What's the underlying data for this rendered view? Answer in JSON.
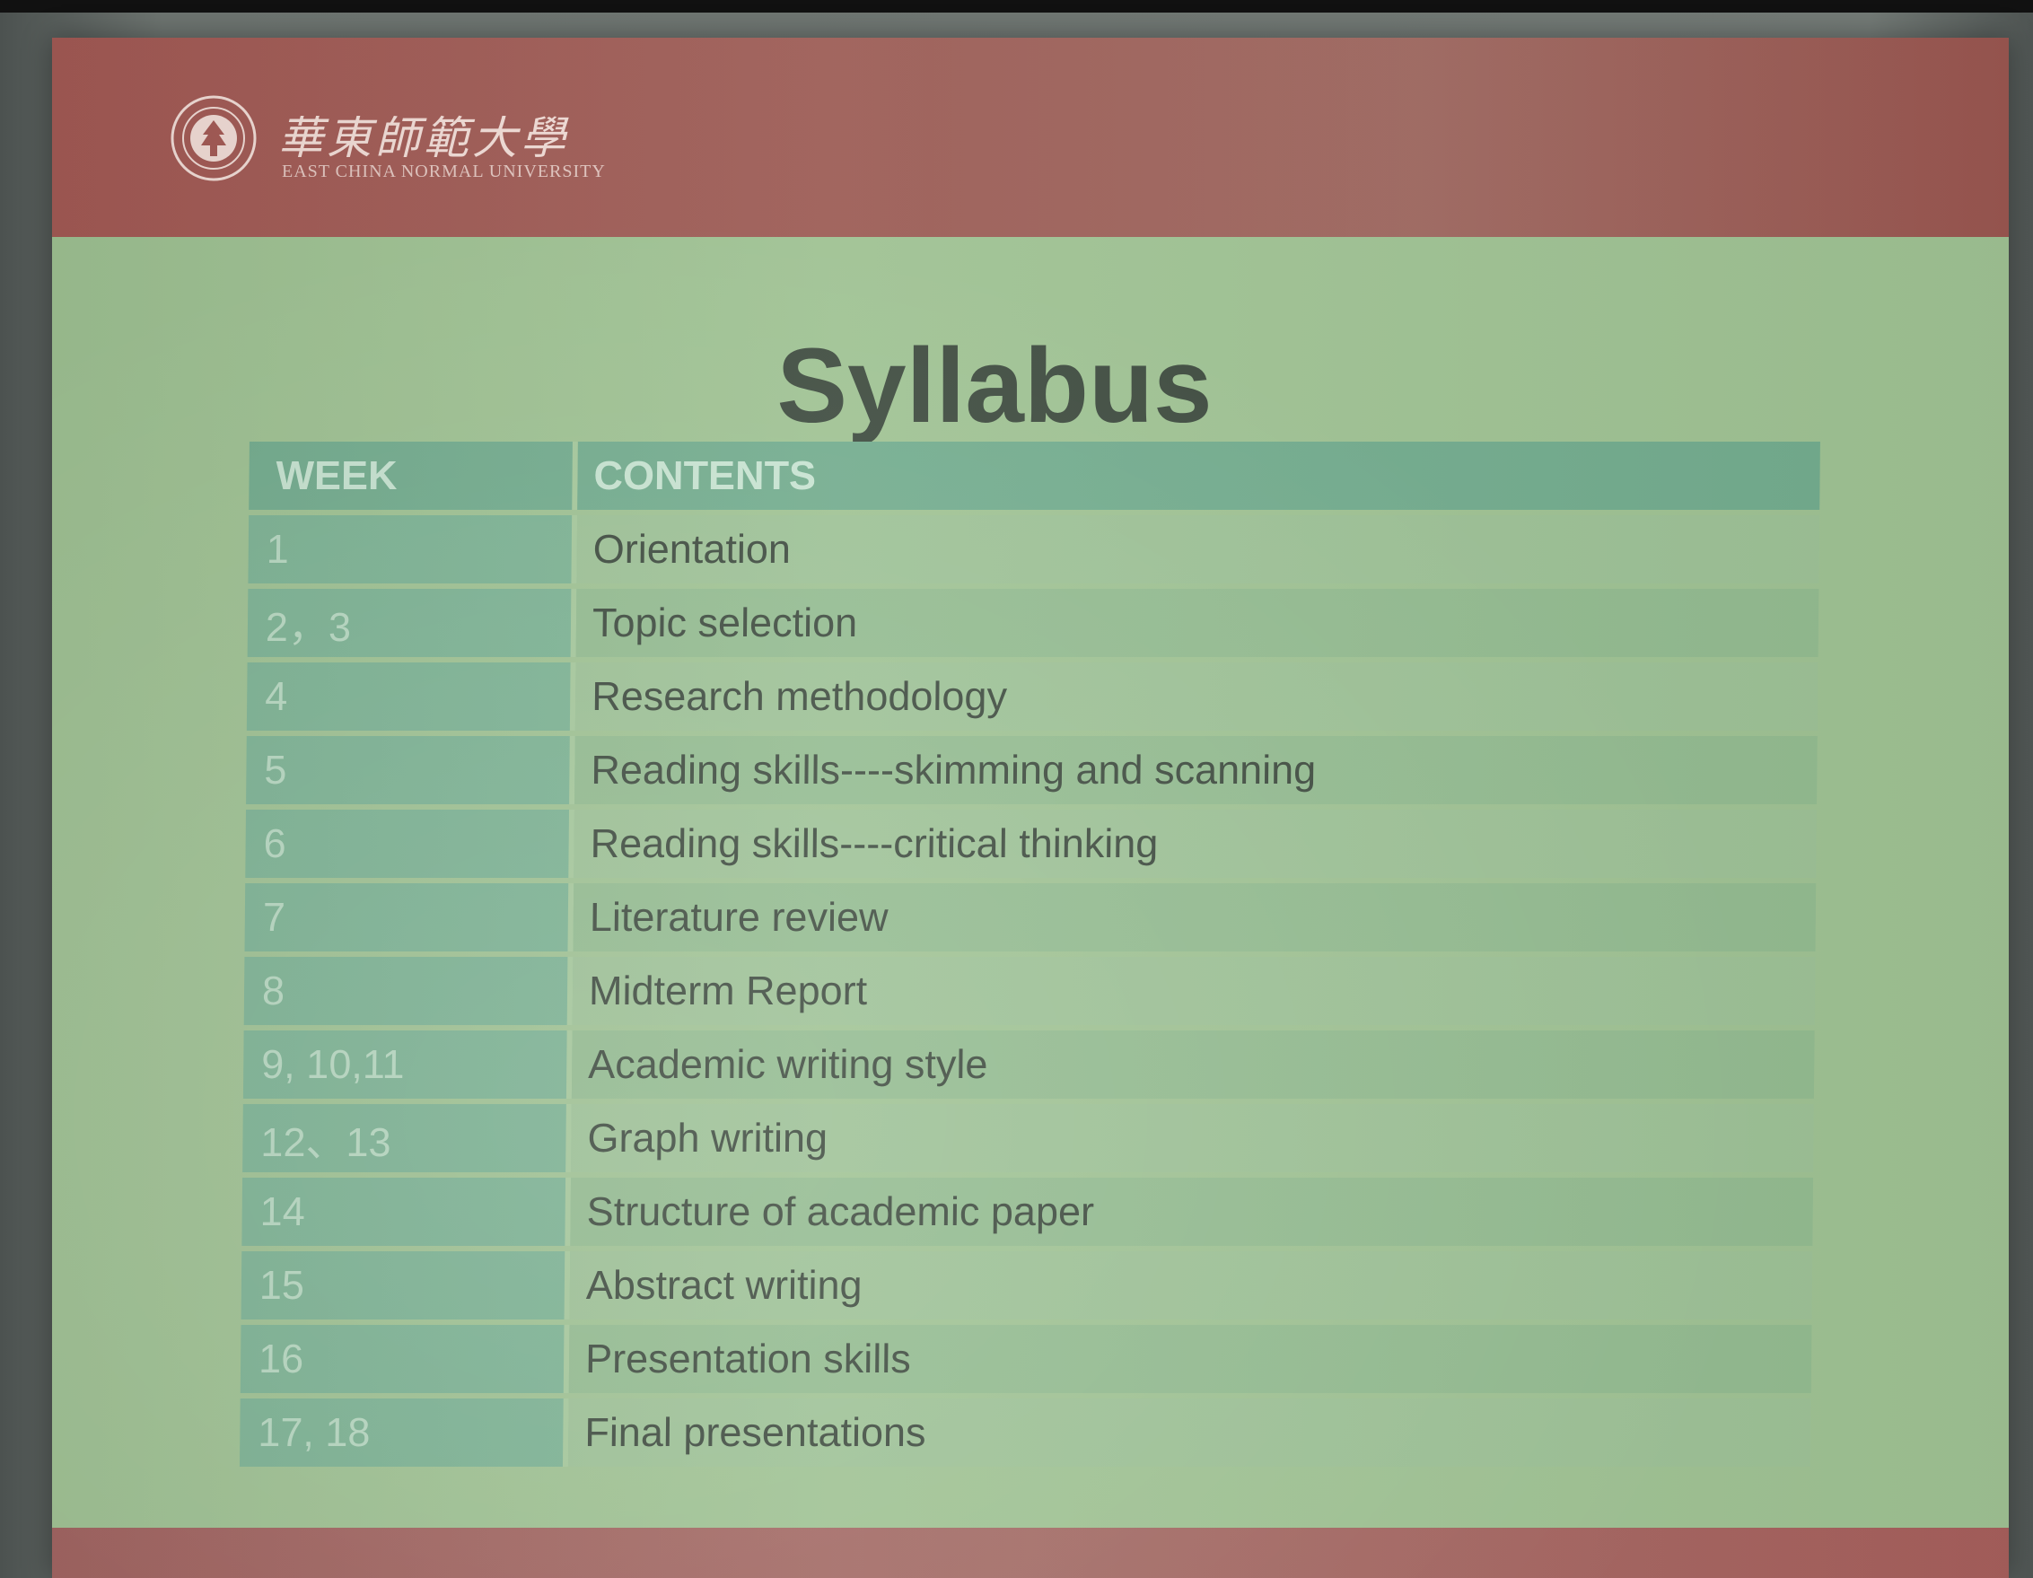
{
  "header": {
    "university_cn": "華東師範大學",
    "university_en": "EAST CHINA NORMAL UNIVERSITY"
  },
  "title": "Syllabus",
  "table": {
    "headers": [
      "WEEK",
      "CONTENTS"
    ],
    "rows": [
      {
        "week": "1",
        "content": "Orientation"
      },
      {
        "week": "2，3",
        "content": "Topic selection"
      },
      {
        "week": "4",
        "content": "Research methodology"
      },
      {
        "week": "5",
        "content": "Reading skills----skimming and scanning"
      },
      {
        "week": "6",
        "content": "Reading skills----critical thinking"
      },
      {
        "week": "7",
        "content": "Literature review"
      },
      {
        "week": "8",
        "content": "Midterm Report"
      },
      {
        "week": "9, 10,11",
        "content": "Academic writing style"
      },
      {
        "week": "12、13",
        "content": "Graph writing"
      },
      {
        "week": "14",
        "content": "Structure of academic paper"
      },
      {
        "week": "15",
        "content": "Abstract writing"
      },
      {
        "week": "16",
        "content": "Presentation skills"
      },
      {
        "week": "17, 18",
        "content": "Final presentations"
      }
    ]
  },
  "colors": {
    "header_band": "#a45a55",
    "slide_background": "#9fc293",
    "table_header": "#73ac8e",
    "week_column": "#7db394",
    "title_text": "#3f4c40"
  },
  "icons": {
    "logo": "university-seal-icon"
  }
}
